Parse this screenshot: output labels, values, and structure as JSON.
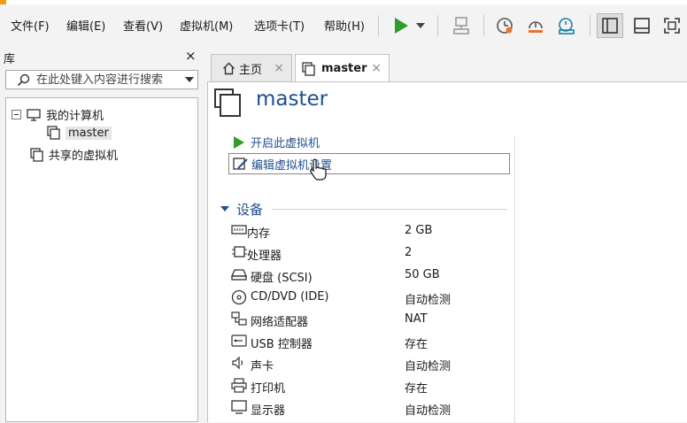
{
  "menu": {
    "items": [
      {
        "label": "文件(F)"
      },
      {
        "label": "编辑(E)"
      },
      {
        "label": "查看(V)"
      },
      {
        "label": "虚拟机(M)"
      },
      {
        "label": "选项卡(T)"
      },
      {
        "label": "帮助(H)"
      }
    ]
  },
  "toolbar": {
    "play_color": "#2e9d2e",
    "icons": [
      "play-icon",
      "dropdown-arrow-icon",
      "send-ctrl-alt-del-icon",
      "snapshot-take-icon",
      "snapshot-revert-icon",
      "snapshot-manager-icon",
      "library-view-icon",
      "thumbnail-view-icon",
      "fullscreen-icon"
    ]
  },
  "library": {
    "title": "库",
    "close_glyph": "×",
    "search_placeholder": "在此处键入内容进行搜索",
    "tree": {
      "root_label": "我的计算机",
      "vm_label": "master",
      "shared_label": "共享的虚拟机"
    }
  },
  "tabs": [
    {
      "label": "主页",
      "close": "×"
    },
    {
      "label": "master",
      "close": "×"
    }
  ],
  "vm": {
    "title": "master",
    "actions": {
      "start": "开启此虚拟机",
      "edit": "编辑虚拟机设置"
    },
    "devices_title": "设备",
    "devices": [
      {
        "name": "内存",
        "value": "2 GB",
        "icon": "memory-icon"
      },
      {
        "name": "处理器",
        "value": "2",
        "icon": "cpu-icon"
      },
      {
        "name": "硬盘 (SCSI)",
        "value": "50 GB",
        "icon": "hard-disk-icon"
      },
      {
        "name": "CD/DVD (IDE)",
        "value": "自动检测",
        "icon": "cd-dvd-icon"
      },
      {
        "name": "网络适配器",
        "value": "NAT",
        "icon": "network-adapter-icon"
      },
      {
        "name": "USB 控制器",
        "value": "存在",
        "icon": "usb-icon"
      },
      {
        "name": "声卡",
        "value": "自动检测",
        "icon": "sound-card-icon"
      },
      {
        "name": "打印机",
        "value": "存在",
        "icon": "printer-icon"
      },
      {
        "name": "显示器",
        "value": "自动检测",
        "icon": "display-icon"
      }
    ]
  },
  "colors": {
    "accent_blue": "#1f4f8f",
    "play_green": "#2e9d2e",
    "snapshot_orange": "#e8752a"
  }
}
